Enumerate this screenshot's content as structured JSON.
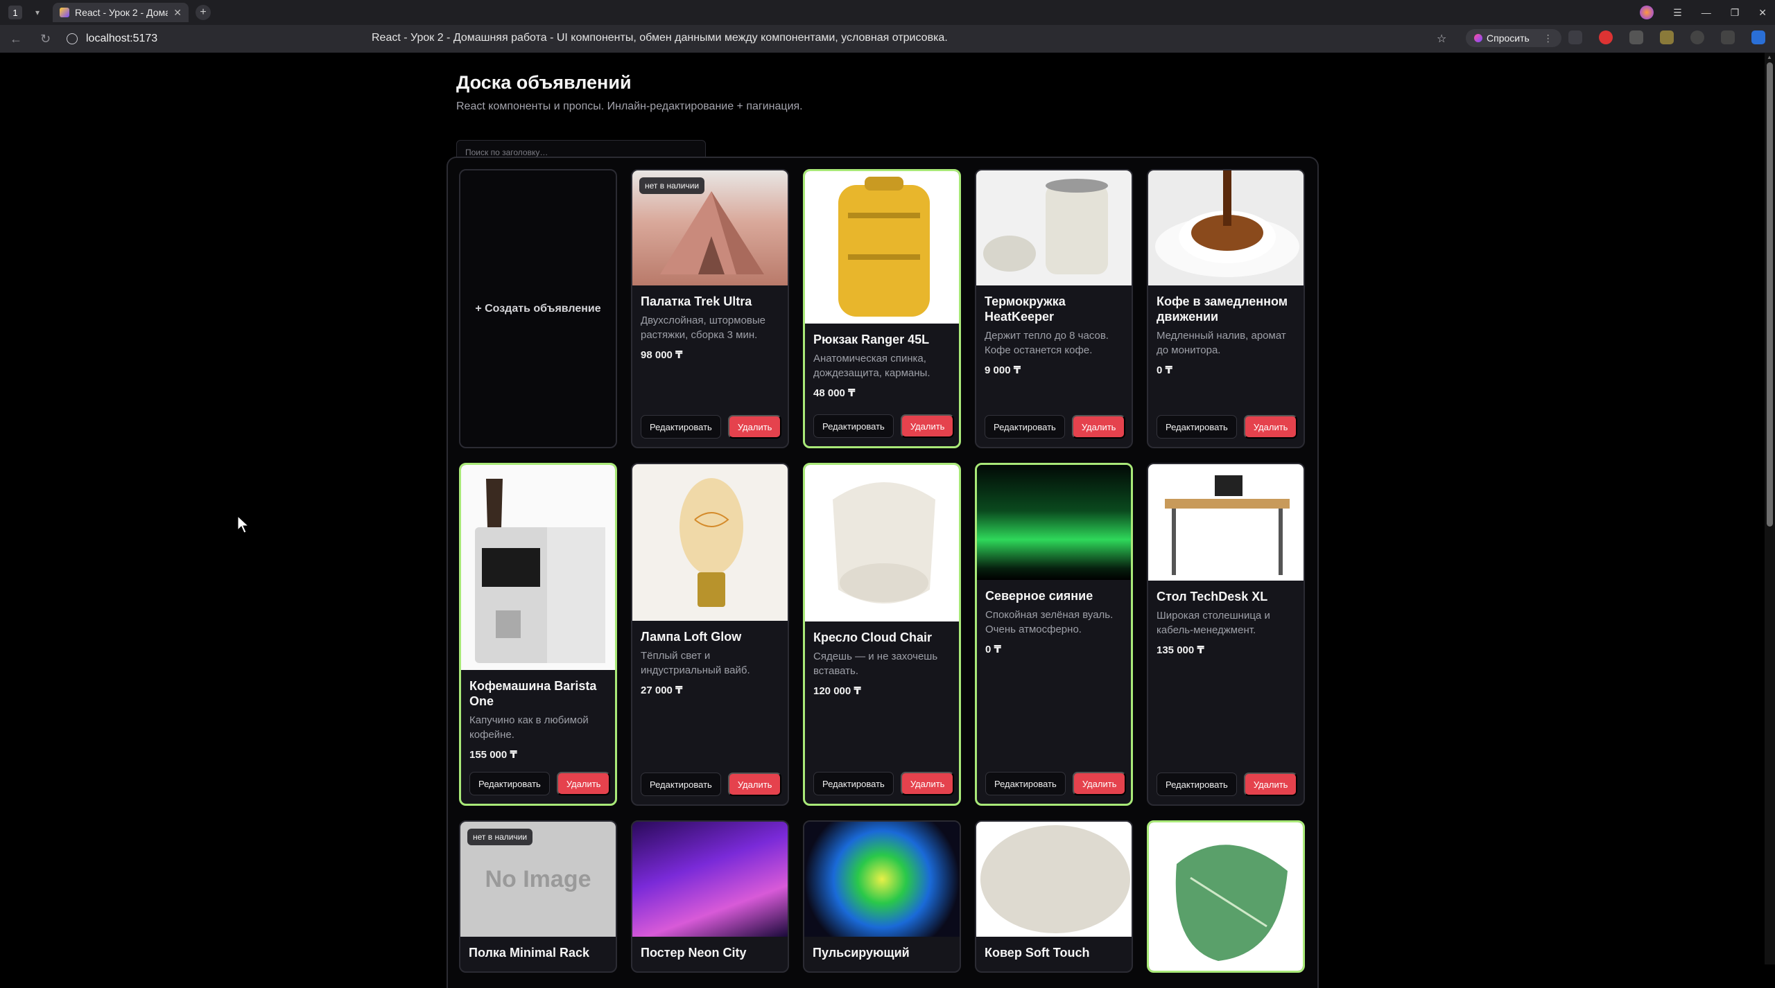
{
  "browser": {
    "tab_count": "1",
    "tab_title": "React - Урок 2 - Домаш",
    "url": "localhost:5173",
    "page_title": "React - Урок 2 - Домашняя работа - UI компоненты, обмен данными между компонентами, условная отрисовка.",
    "ask_label": "Спросить"
  },
  "page": {
    "title": "Доска объявлений",
    "subtitle": "React компоненты и пропсы. Инлайн-редактирование + пагинация.",
    "search_placeholder": "Поиск по заголовку…",
    "create_label": "+ Создать объявление"
  },
  "actions": {
    "edit": "Редактировать",
    "delete": "Удалить"
  },
  "cards": [
    {
      "name": "Палатка Trek Ultra",
      "desc": "Двухслойная, штормовые растяжки, сборка 3 мин.",
      "price": "98 000 ₸",
      "badge": "нет в наличии"
    },
    {
      "name": "Рюкзак Ranger 45L",
      "desc": "Анатомическая спинка, дождезащита, карманы.",
      "price": "48 000 ₸"
    },
    {
      "name": "Термокружка HeatKeeper",
      "desc": "Держит тепло до 8 часов. Кофе останется кофе.",
      "price": "9 000 ₸"
    },
    {
      "name": "Кофе в замедленном движении",
      "desc": "Медленный налив, аромат до монитора.",
      "price": "0 ₸"
    },
    {
      "name": "Кофемашина Barista One",
      "desc": "Капучино как в любимой кофейне.",
      "price": "155 000 ₸"
    },
    {
      "name": "Лампа Loft Glow",
      "desc": "Тёплый свет и индустриальный вайб.",
      "price": "27 000 ₸"
    },
    {
      "name": "Кресло Cloud Chair",
      "desc": "Сядешь — и не захочешь вставать.",
      "price": "120 000 ₸"
    },
    {
      "name": "Северное сияние",
      "desc": "Спокойная зелёная вуаль. Очень атмосферно.",
      "price": "0 ₸"
    },
    {
      "name": "Стол TechDesk XL",
      "desc": "Широкая столешница и кабель-менеджмент.",
      "price": "135 000 ₸"
    },
    {
      "name": "Полка Minimal Rack",
      "badge": "нет в наличии",
      "no_image": "No Image"
    },
    {
      "name": "Постер Neon City"
    },
    {
      "name": "Пульсирующий"
    },
    {
      "name": "Ковер Soft Touch"
    },
    {
      "name": ""
    }
  ]
}
